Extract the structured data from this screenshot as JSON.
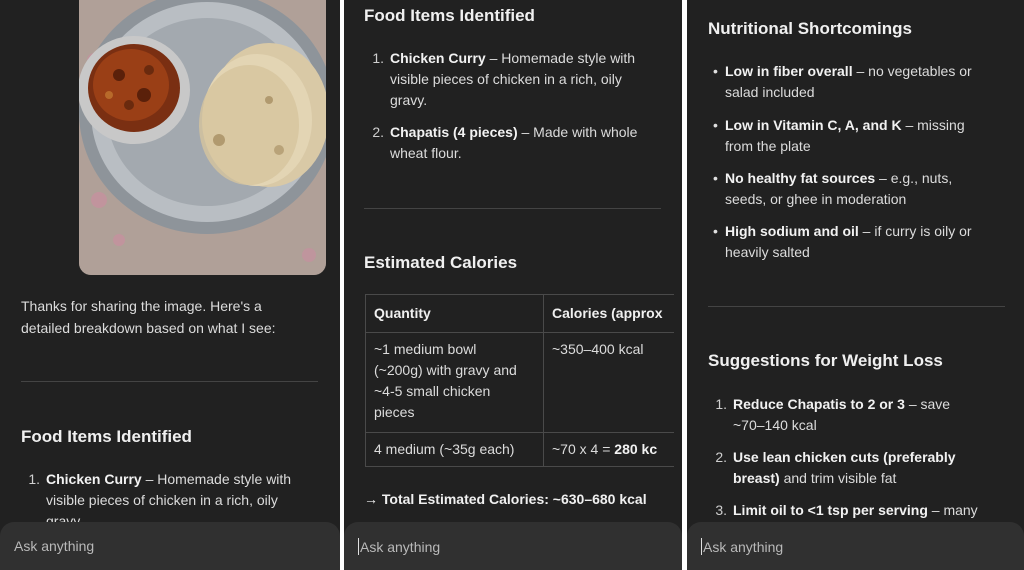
{
  "panel1": {
    "intro_line1": "Thanks for sharing the image. Here's a",
    "intro_line2": "detailed breakdown based on what I see:",
    "heading": "Food Items Identified",
    "item1_num": "1.",
    "item1_bold": "Chicken Curry",
    "item1_line1_rest": " – Homemade style with",
    "item1_line2": "visible pieces of chicken in a rich, oily",
    "item1_line3": "gravy"
  },
  "panel2": {
    "heading": "Food Items Identified",
    "item1_num": "1.",
    "item1_bold": "Chicken Curry",
    "item1_line1_rest": " – Homemade style with",
    "item1_line2": "visible pieces of chicken in a rich, oily",
    "item1_line3": "gravy.",
    "item2_num": "2.",
    "item2_bold": "Chapatis (4 pieces)",
    "item2_line1_rest": " – Made with whole",
    "item2_line2": "wheat flour.",
    "heading2": "Estimated Calories",
    "table": {
      "col1": "Quantity",
      "col2": "Calories (approx",
      "r1c1_l1": "~1 medium bowl",
      "r1c1_l2": "(~200g) with gravy and",
      "r1c1_l3": "~4-5 small chicken",
      "r1c1_l4": "pieces",
      "r1c2": "~350–400 kcal",
      "r2c1": "4 medium (~35g each)",
      "r2c2_plain": "~70 x 4 = ",
      "r2c2_bold": "280 kc"
    },
    "total": "→ Total Estimated Calories: ~630–680 kcal"
  },
  "panel3": {
    "heading": "Nutritional Shortcomings",
    "bullet_glyph": "•",
    "b1_bold": "Low in fiber overall",
    "b1_rest": " – no vegetables or",
    "b1_line2": "salad included",
    "b2_bold": "Low in Vitamin C, A, and K",
    "b2_rest": " – missing",
    "b2_line2": "from the plate",
    "b3_bold": "No healthy fat sources",
    "b3_rest": " – e.g., nuts,",
    "b3_line2": "seeds, or ghee in moderation",
    "b4_bold": "High sodium and oil",
    "b4_rest": " – if curry is oily or",
    "b4_line2": "heavily salted",
    "heading2": "Suggestions for Weight Loss",
    "s1_num": "1.",
    "s1_bold": "Reduce Chapatis to 2 or 3",
    "s1_rest": " – save",
    "s1_line2": "~70–140 kcal",
    "s2_num": "2.",
    "s2_bold_l1": "Use lean chicken cuts (preferably",
    "s2_bold_l2": "breast)",
    "s2_rest_l2": " and trim visible fat",
    "s3_num": "3.",
    "s3_bold": "Limit oil to <1 tsp per serving",
    "s3_rest": " – many"
  },
  "input": {
    "placeholder": "Ask anything"
  },
  "colors": {
    "background": "#212121",
    "input_bar": "#303030",
    "divider": "#444444"
  }
}
